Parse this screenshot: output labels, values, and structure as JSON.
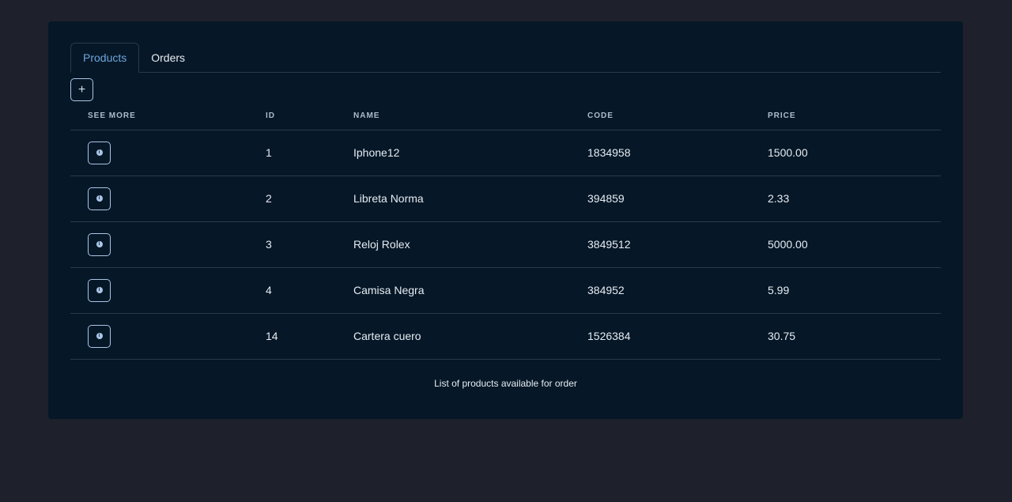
{
  "tabs": [
    {
      "label": "Products",
      "active": true
    },
    {
      "label": "Orders",
      "active": false
    }
  ],
  "add_button": {
    "label": "+"
  },
  "table": {
    "headers": [
      "SEE MORE",
      "ID",
      "NAME",
      "CODE",
      "PRICE"
    ],
    "rows": [
      {
        "id": "1",
        "name": "Iphone12",
        "code": "1834958",
        "price": "1500.00"
      },
      {
        "id": "2",
        "name": "Libreta Norma",
        "code": "394859",
        "price": "2.33"
      },
      {
        "id": "3",
        "name": "Reloj Rolex",
        "code": "3849512",
        "price": "5000.00"
      },
      {
        "id": "4",
        "name": "Camisa Negra",
        "code": "384952",
        "price": "5.99"
      },
      {
        "id": "14",
        "name": "Cartera cuero",
        "code": "1526384",
        "price": "30.75"
      }
    ]
  },
  "caption": "List of products available for order",
  "icons": {
    "see_more": "info-circle-icon",
    "add": "plus-icon"
  },
  "colors": {
    "page_bg": "#1e212b",
    "card_bg": "#061727",
    "accent": "#6ea6dc",
    "border": "#2a3a4c"
  }
}
